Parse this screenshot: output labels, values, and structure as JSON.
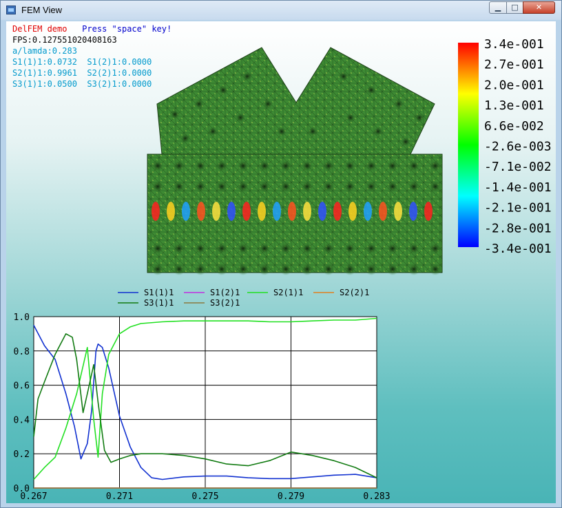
{
  "window": {
    "title": "FEM View",
    "min_glyph": "▁",
    "max_glyph": "□",
    "close_glyph": "✕"
  },
  "overlay": {
    "demo": "DelFEM demo",
    "press": "Press \"space\" key!",
    "fps": "FPS:0.127551020408163",
    "a_lambda": "a/lamda:0.283",
    "s1": "S1(1)1:0.0732  S1(2)1:0.0000",
    "s2": "S2(1)1:0.9961  S2(2)1:0.0000",
    "s3": "S3(1)1:0.0500  S3(2)1:0.0000"
  },
  "colors": {
    "demo": "#e00000",
    "press": "#0000cc",
    "fps": "#000000",
    "info": "#0099cc",
    "mesh": "#3d8a33",
    "S1(1)1": "#1030d0",
    "S1(2)1": "#c030e0",
    "S2(1)1": "#20e020",
    "S2(2)1": "#e08020",
    "S3(1)1": "#107a10",
    "S3(2)1": "#8a7a40"
  },
  "colorbar": {
    "labels": [
      "3.4e-001",
      "2.7e-001",
      "2.0e-001",
      "1.3e-001",
      "6.6e-002",
      "-2.6e-003",
      "-7.1e-002",
      "-1.4e-001",
      "-2.1e-001",
      "-2.8e-001",
      "-3.4e-001"
    ]
  },
  "chart_data": {
    "type": "line",
    "xlim": [
      0.267,
      0.283
    ],
    "ylim": [
      0,
      1
    ],
    "x_ticks": [
      "0.267",
      "0.271",
      "0.275",
      "0.279",
      "0.283"
    ],
    "y_ticks": [
      "0.0",
      "0.2",
      "0.4",
      "0.6",
      "0.8",
      "1.0"
    ],
    "grid": true,
    "legend": "top",
    "series": [
      {
        "name": "S1(1)1",
        "x": [
          0.267,
          0.2675,
          0.268,
          0.2685,
          0.2689,
          0.2692,
          0.2695,
          0.2697,
          0.2699,
          0.27,
          0.2702,
          0.2705,
          0.271,
          0.2715,
          0.272,
          0.2725,
          0.273,
          0.274,
          0.275,
          0.276,
          0.277,
          0.278,
          0.279,
          0.28,
          0.281,
          0.282,
          0.283
        ],
        "y": [
          0.95,
          0.83,
          0.75,
          0.55,
          0.36,
          0.17,
          0.26,
          0.45,
          0.8,
          0.84,
          0.82,
          0.7,
          0.42,
          0.24,
          0.12,
          0.06,
          0.05,
          0.065,
          0.07,
          0.07,
          0.06,
          0.055,
          0.055,
          0.065,
          0.075,
          0.08,
          0.06
        ]
      },
      {
        "name": "S1(2)1",
        "x": [
          0.267,
          0.283
        ],
        "y": [
          0,
          0
        ]
      },
      {
        "name": "S2(1)1",
        "x": [
          0.267,
          0.2675,
          0.268,
          0.2685,
          0.269,
          0.2695,
          0.2698,
          0.27,
          0.2702,
          0.2705,
          0.271,
          0.2715,
          0.272,
          0.273,
          0.274,
          0.275,
          0.276,
          0.277,
          0.278,
          0.279,
          0.28,
          0.281,
          0.282,
          0.283
        ],
        "y": [
          0.05,
          0.12,
          0.18,
          0.35,
          0.55,
          0.82,
          0.4,
          0.18,
          0.55,
          0.78,
          0.9,
          0.94,
          0.96,
          0.97,
          0.975,
          0.975,
          0.975,
          0.975,
          0.97,
          0.97,
          0.975,
          0.98,
          0.98,
          0.99
        ]
      },
      {
        "name": "S2(2)1",
        "x": [
          0.267,
          0.283
        ],
        "y": [
          0,
          0
        ]
      },
      {
        "name": "S3(1)1",
        "x": [
          0.267,
          0.2672,
          0.2675,
          0.268,
          0.2685,
          0.2688,
          0.269,
          0.2693,
          0.2695,
          0.2698,
          0.27,
          0.2703,
          0.2706,
          0.271,
          0.2715,
          0.272,
          0.273,
          0.274,
          0.275,
          0.276,
          0.277,
          0.278,
          0.279,
          0.28,
          0.281,
          0.282,
          0.283
        ],
        "y": [
          0.3,
          0.52,
          0.62,
          0.78,
          0.9,
          0.88,
          0.75,
          0.44,
          0.55,
          0.72,
          0.5,
          0.22,
          0.15,
          0.17,
          0.19,
          0.2,
          0.2,
          0.19,
          0.17,
          0.14,
          0.13,
          0.16,
          0.21,
          0.19,
          0.16,
          0.12,
          0.06
        ]
      },
      {
        "name": "S3(2)1",
        "x": [
          0.267,
          0.283
        ],
        "y": [
          0,
          0
        ]
      }
    ]
  }
}
